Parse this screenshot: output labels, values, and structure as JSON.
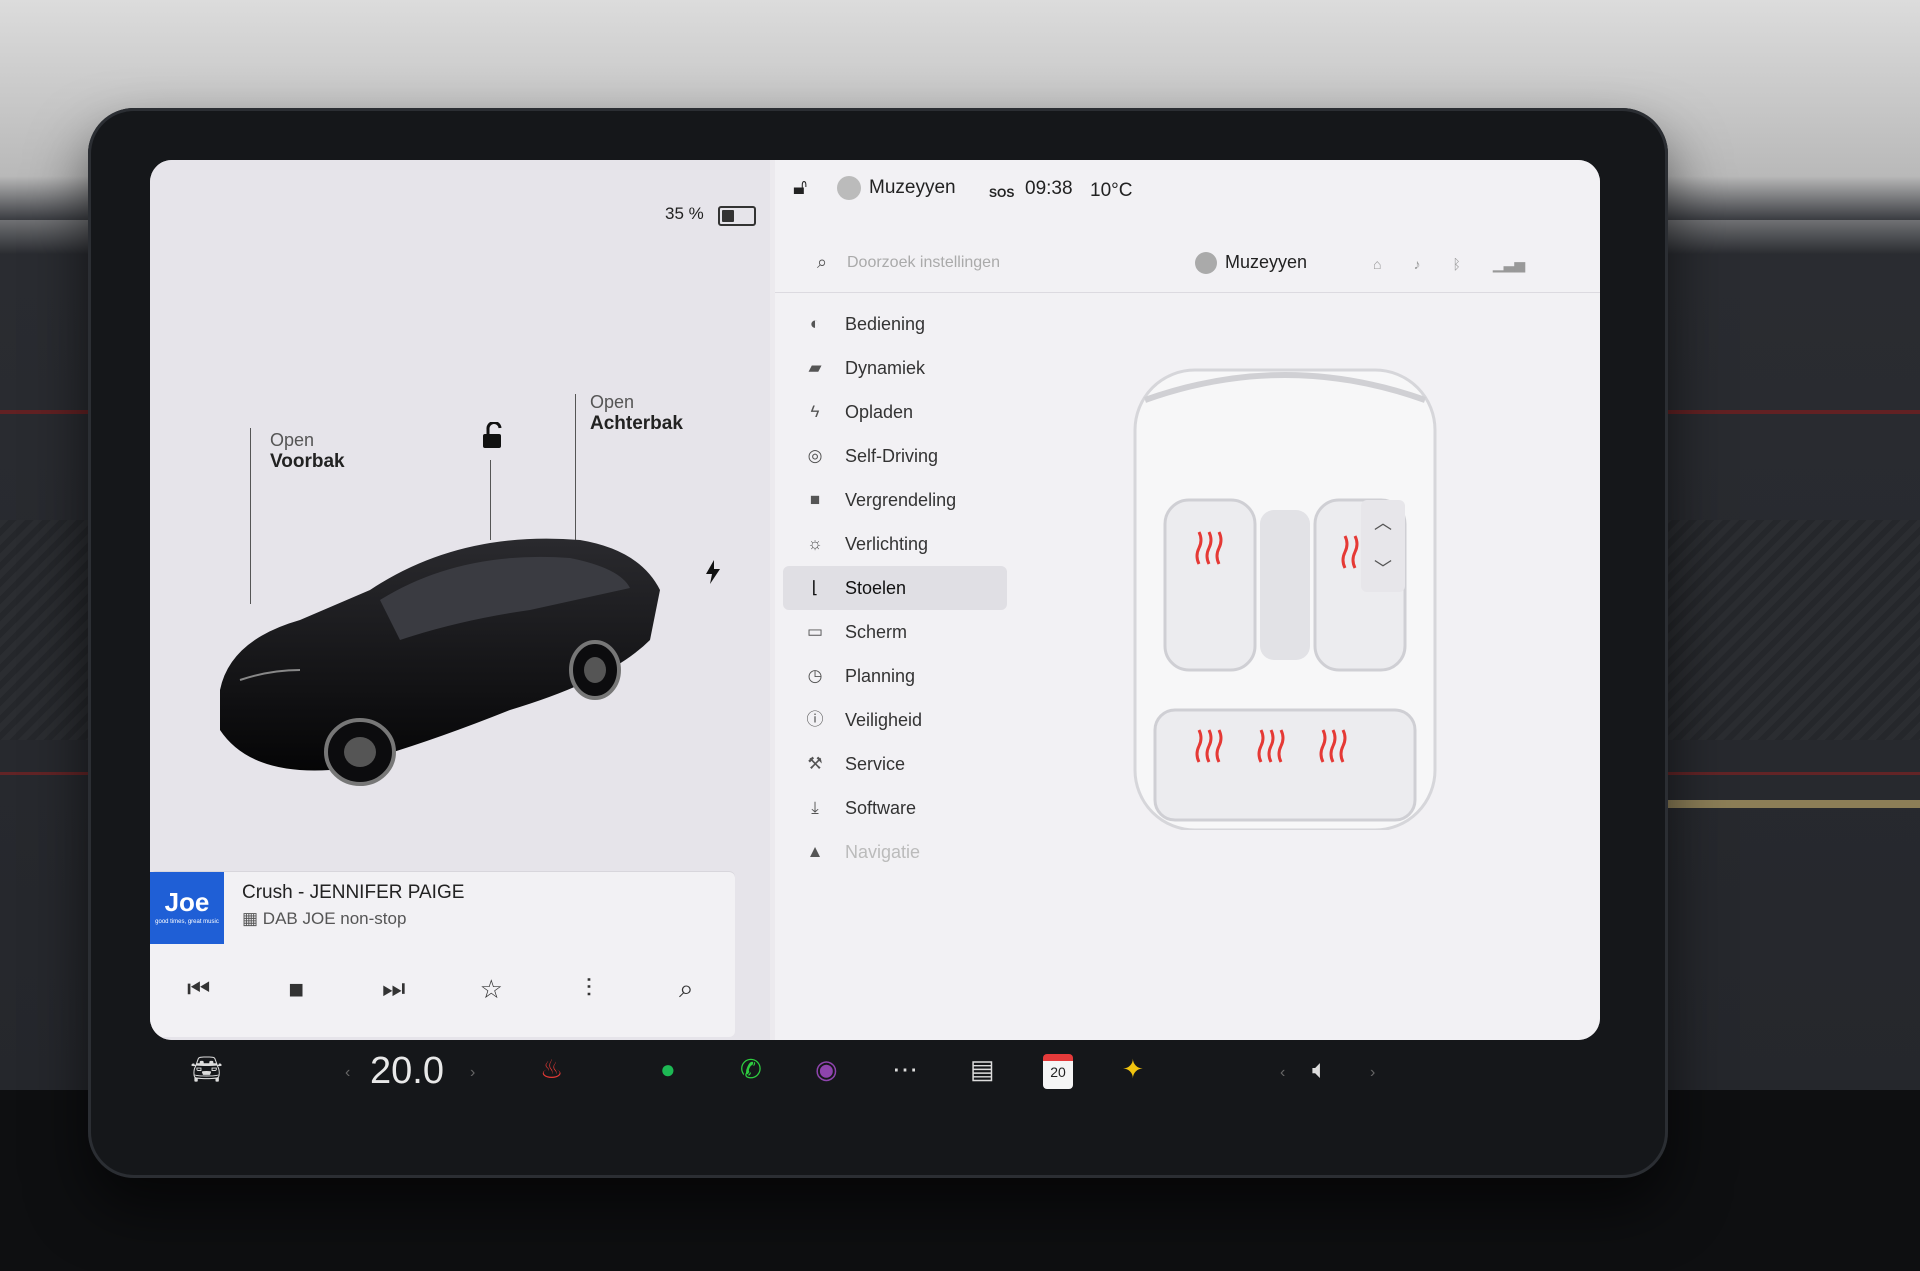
{
  "status": {
    "battery_percent": "35 %",
    "battery_level": 0.35,
    "user": "Muzeyyen",
    "sos": "SOS",
    "time": "09:38",
    "outside_temp": "10°C"
  },
  "vehicle": {
    "frunk": {
      "action": "Open",
      "name": "Voorbak"
    },
    "trunk": {
      "action": "Open",
      "name": "Achterbak"
    }
  },
  "media": {
    "logo": "Joe",
    "logo_tagline": "good times, great music",
    "title": "Crush - JENNIFER PAIGE",
    "source": "DAB JOE non-stop"
  },
  "settings": {
    "search_placeholder": "Doorzoek instellingen",
    "profile": "Muzeyyen",
    "menu": [
      {
        "label": "Bediening",
        "icon": "toggle-icon"
      },
      {
        "label": "Dynamiek",
        "icon": "car-icon"
      },
      {
        "label": "Opladen",
        "icon": "bolt-icon"
      },
      {
        "label": "Self-Driving",
        "icon": "steering-wheel-icon"
      },
      {
        "label": "Vergrendeling",
        "icon": "lock-icon"
      },
      {
        "label": "Verlichting",
        "icon": "light-icon"
      },
      {
        "label": "Stoelen",
        "icon": "seat-icon",
        "active": true
      },
      {
        "label": "Scherm",
        "icon": "display-icon"
      },
      {
        "label": "Planning",
        "icon": "clock-icon"
      },
      {
        "label": "Veiligheid",
        "icon": "info-icon"
      },
      {
        "label": "Service",
        "icon": "wrench-icon"
      },
      {
        "label": "Software",
        "icon": "download-icon"
      },
      {
        "label": "Navigatie",
        "icon": "navigation-icon"
      }
    ]
  },
  "dock": {
    "cabin_temp": "20.0"
  },
  "colors": {
    "accent": "#111111",
    "seat_heat": "#e53935",
    "spotify": "#1db954",
    "phone": "#2ecc40",
    "media_logo": "#1f5fd6"
  }
}
